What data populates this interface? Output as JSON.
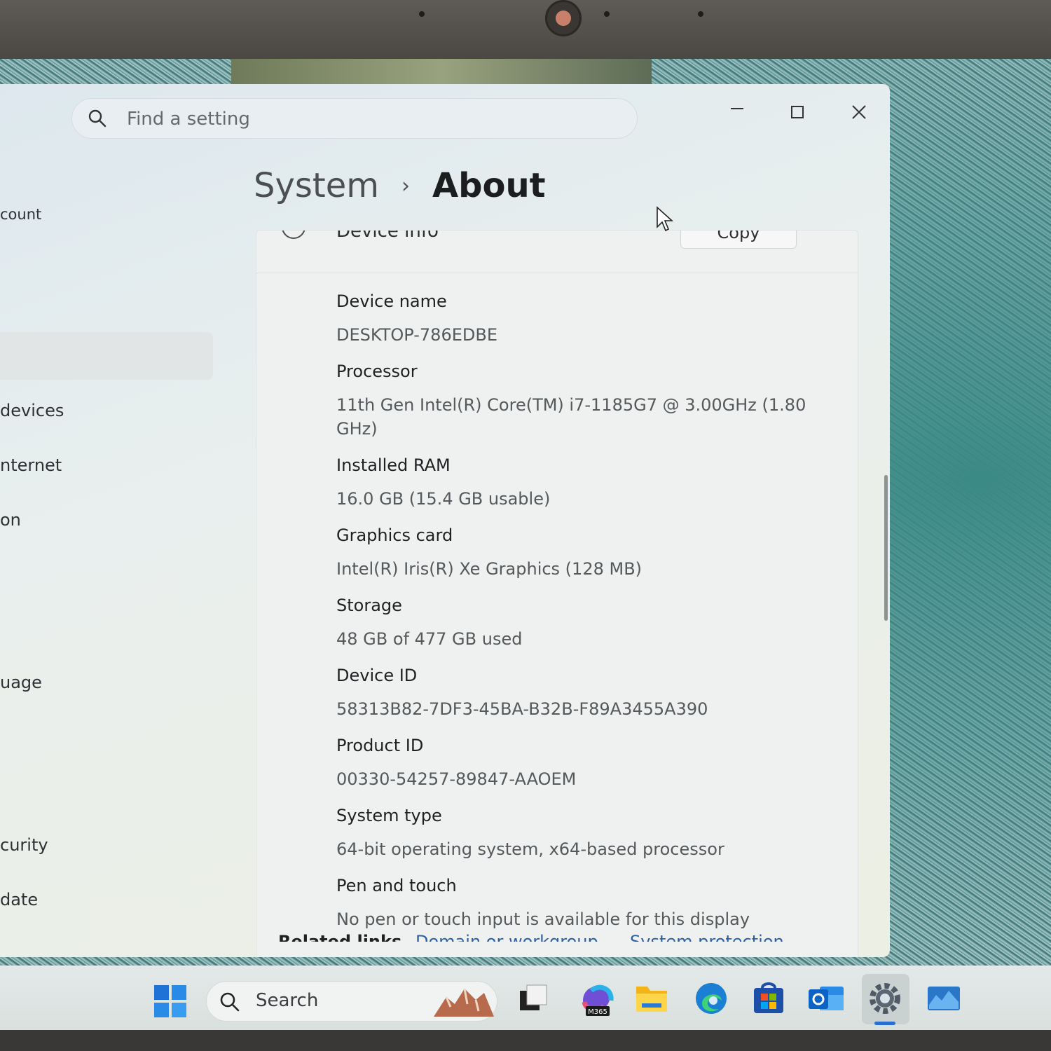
{
  "search": {
    "placeholder": "Find a setting"
  },
  "breadcrumb": {
    "parent": "System",
    "separator": "›",
    "current": "About"
  },
  "sidebar": {
    "items": [
      {
        "label": "count"
      },
      {
        "label": "devices"
      },
      {
        "label": "nternet"
      },
      {
        "label": "on"
      },
      {
        "label": "uage"
      },
      {
        "label": "curity"
      },
      {
        "label": "date"
      }
    ]
  },
  "device_card": {
    "title": "Device info",
    "copy_label": "Copy",
    "specs": [
      {
        "label": "Device name",
        "value": "DESKTOP-786EDBE"
      },
      {
        "label": "Processor",
        "value": "11th Gen Intel(R) Core(TM) i7-1185G7 @ 3.00GHz (1.80 GHz)"
      },
      {
        "label": "Installed RAM",
        "value": "16.0 GB (15.4 GB usable)"
      },
      {
        "label": "Graphics card",
        "value": "Intel(R) Iris(R) Xe Graphics (128 MB)"
      },
      {
        "label": "Storage",
        "value": "48 GB of 477 GB used"
      },
      {
        "label": "Device ID",
        "value": "58313B82-7DF3-45BA-B32B-F89A3455A390"
      },
      {
        "label": "Product ID",
        "value": "00330-54257-89847-AAOEM"
      },
      {
        "label": "System type",
        "value": "64-bit operating system, x64-based processor"
      },
      {
        "label": "Pen and touch",
        "value": "No pen or touch input is available for this display"
      }
    ]
  },
  "related": {
    "label": "Related links",
    "links": [
      "Domain or workgroup",
      "System protection"
    ]
  },
  "taskbar": {
    "search_label": "Search",
    "m365_badge": "M365"
  },
  "colors": {
    "accent": "#2a6fd0",
    "link": "#2a5fa6"
  }
}
